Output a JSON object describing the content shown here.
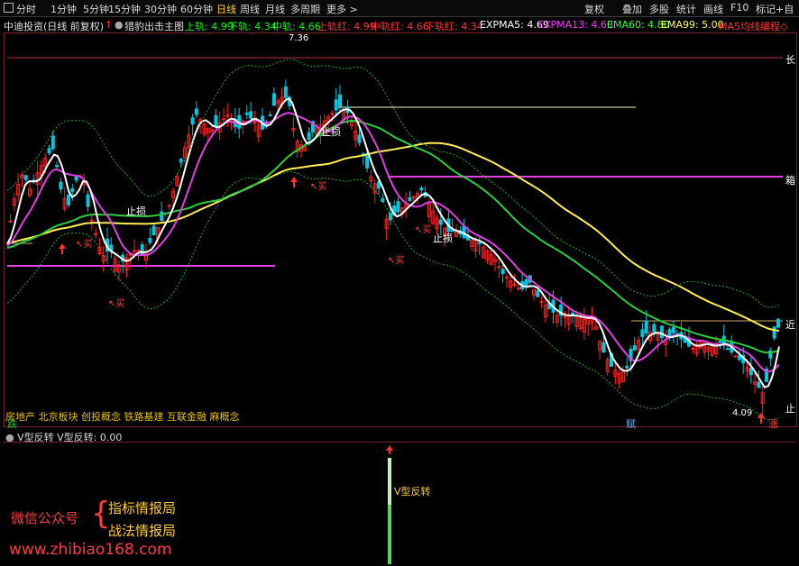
{
  "toolbar": {
    "left_items": [
      "分时",
      "1分钟",
      "5分钟",
      "15分钟",
      "30分钟",
      "60分钟",
      "日线",
      "周线",
      "月线",
      "多周期",
      "更多 >"
    ],
    "right_items": [
      "复权",
      "叠加",
      "多股",
      "统计",
      "画线",
      "F10",
      "标记",
      "+自"
    ]
  },
  "legend": {
    "stock": "中迪投资(日线 前复权)",
    "indicator": "猎豹出击主图",
    "items": [
      {
        "label": "上轨: 4.99",
        "color": "#00ff00"
      },
      {
        "label": "下轨: 4.34",
        "color": "#00ff00"
      },
      {
        "label": "中轨: 4.66",
        "color": "#00ff00"
      },
      {
        "label": "上轨红: 4.99",
        "color": "#ff3333"
      },
      {
        "label": "中轨红: 4.66",
        "color": "#ff3333"
      },
      {
        "label": "下轨红: 4.34",
        "color": "#ff3333"
      },
      {
        "label": "EXPMA5: 4.69",
        "color": "#ffffff"
      },
      {
        "label": "EXPMA13: 4.60",
        "color": "#ff33ff"
      },
      {
        "label": "EMA60: 4.80",
        "color": "#33ff33"
      },
      {
        "label": "EMA99: 5.00",
        "color": "#ffff55"
      },
      {
        "label": "MA5均线编程◇",
        "color": "#ff3333"
      }
    ]
  },
  "chart_labels": {
    "high": "7.36",
    "low": "4.09",
    "stops": [
      "止损",
      "止损",
      "止损",
      "止损"
    ],
    "buys": [
      "买",
      "买",
      "买",
      "买",
      "买"
    ],
    "right": [
      "长",
      "箱",
      "近",
      "止"
    ]
  },
  "concepts": "房地产 北京板块 创投概念 铁路基建 互联金融 麻概念",
  "x_labels": [
    "跌",
    "赋",
    "涨"
  ],
  "sub_chart": {
    "legend_title": "V型反转",
    "legend_value": "V型反转: 0.00",
    "signal_label": "V型反转"
  },
  "watermark": {
    "wechat": "微信公众号",
    "brace": "{",
    "line1": "指标情报局",
    "line2": "战法情报局",
    "site": "www.zhibiao168.com"
  },
  "colors": {
    "up": "#ff2020",
    "down": "#00c8e0",
    "ema60": "#2ecc40",
    "ema99": "#ffee55",
    "expma5": "#ffffff",
    "expma13": "#e040e0"
  }
}
